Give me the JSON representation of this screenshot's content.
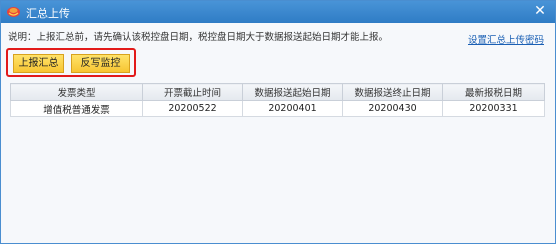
{
  "window": {
    "title": "汇总上传",
    "close_glyph": "✕"
  },
  "notice": "说明：上报汇总前，请先确认该税控盘日期，税控盘日期大于数据报送起始日期才能上报。",
  "set_password_link": "设置汇总上传密码",
  "buttons": {
    "upload_summary": "上报汇总",
    "write_back_monitor": "反写监控"
  },
  "colors": {
    "titlebar": "#3584cc",
    "button_yellow": "#f7c532",
    "highlight_red": "#e21a1a",
    "link_blue": "#1a5fb4"
  },
  "table": {
    "headers": [
      "发票类型",
      "开票截止时间",
      "数据报送起始日期",
      "数据报送终止日期",
      "最新报税日期"
    ],
    "rows": [
      [
        "增值税普通发票",
        "20200522",
        "20200401",
        "20200430",
        "20200331"
      ]
    ]
  }
}
